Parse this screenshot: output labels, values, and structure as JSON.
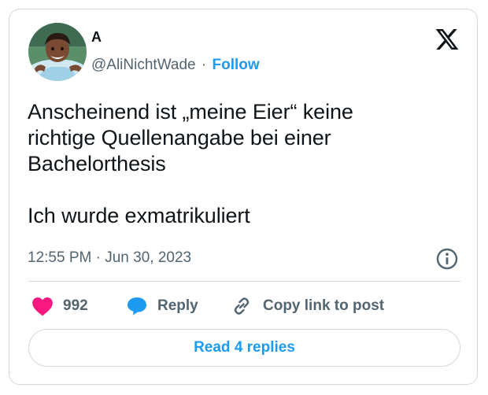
{
  "author": {
    "display_name": "A",
    "handle": "@AliNichtWade",
    "separator": "·",
    "follow_label": "Follow",
    "avatar_icon": "avatar-illustration"
  },
  "platform": {
    "logo_icon": "x-logo-icon"
  },
  "tweet": {
    "text": "Anscheinend ist „meine Eier“ keine\nrichtige Quellenangabe bei einer\nBachelorthesis\n\nIch wurde exmatrikuliert",
    "timestamp": "12:55 PM · Jun 30, 2023"
  },
  "actions": {
    "like_count": "992",
    "like_icon": "heart-icon",
    "like_color": "#f91880",
    "reply_label": "Reply",
    "reply_icon": "speech-bubble-icon",
    "reply_color": "#1d9bf0",
    "copy_label": "Copy link to post",
    "copy_icon": "link-icon"
  },
  "footer": {
    "read_replies_label": "Read 4 replies"
  },
  "colors": {
    "accent": "#1d9bf0",
    "text": "#0f1419",
    "secondary": "#536471",
    "border": "#cfd9de"
  }
}
